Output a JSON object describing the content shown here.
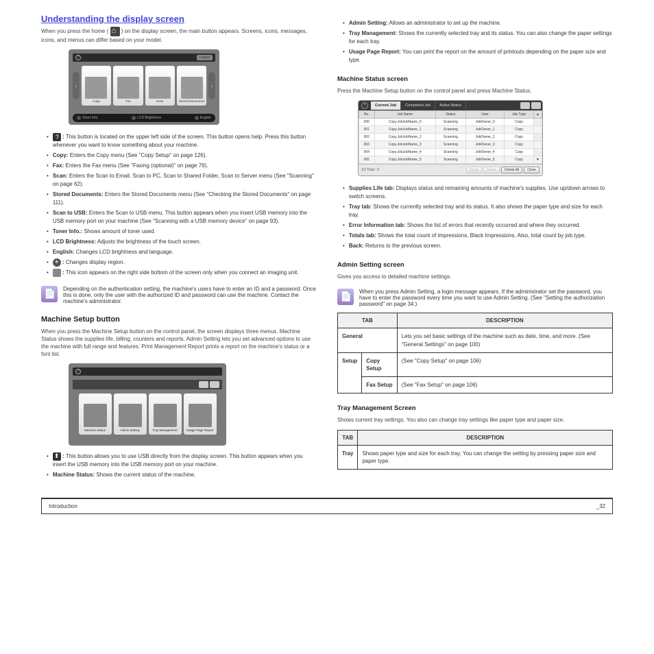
{
  "left": {
    "title": "Understanding the display screen",
    "intro_prefix": "When you press the home (",
    "intro_suffix": ") on the display screen, the main button appears. Screens, icons, messages, icons, and menus can differ based on your model.",
    "main_menu": {
      "topbar_right": "Logout",
      "tiles": [
        "Copy",
        "Fax",
        "Scan",
        "Stored Documents"
      ],
      "bottom": [
        "Toner Info.",
        "LCD Brightness",
        "English"
      ]
    },
    "bullets_1": [
      {
        "bold": ":",
        "text": "This button is located on the upper left side of the screen. This button opens help. Press this button whenever you want to know something about your machine."
      },
      {
        "bold": "Copy:",
        "text": "Enters the Copy menu (See \"Copy Setup\" on page 126)."
      },
      {
        "bold": "Fax:",
        "text": "Enters the Fax menu (See \"Faxing (optional)\" on page 76)."
      },
      {
        "bold": "Scan:",
        "text": "Enters the Scan to Email, Scan to PC, Scan to Shared Folder, Scan to Server menu (See \"Scanning\" on page 62)."
      },
      {
        "bold": "Stored Documents:",
        "text": "Enters the Stored Documents menu (See \"Checking the Stored Documents\" on page 111)."
      },
      {
        "bold": "Scan to USB:",
        "text": "Enters the Scan to USB menu. This button appears when you insert USB memory into the USB memory port on your machine (See \"Scanning with a USB memory device\" on page 93)."
      },
      {
        "bold": "Toner Info.:",
        "text": "Shows amount of toner used."
      },
      {
        "bold": "LCD Brightness:",
        "text": "Adjusts the brightness of the touch screen."
      },
      {
        "bold": "English:",
        "text": "Changes LCD brightness and language."
      },
      {
        "bold": ":",
        "text": "Changes display region."
      },
      {
        "bold": ":",
        "text": "This icon appears on the right side bottom of the screen only when you connect an imaging unit."
      }
    ],
    "note": "Depending on the authentication setting, the machine's users have to enter an ID and a password. Once this is done, only the user with the authorized ID and password can use the machine. Contact the machine's administrator.",
    "subsection_title": "Machine Setup button",
    "subsection_intro": "When you press the Machine Setup button on the control panel, the screen displays three menus. Machine Status shows the supplies life, billing, counters and reports. Admin Setting lets you set advanced options to use the machine with full range and features. Print Management Report prints a report on the machine's status or a font list.",
    "setup_screen": {
      "tiles": [
        "Machine Status",
        "Admin Setting",
        "Tray Management",
        "Usage Page Report"
      ]
    },
    "bullets_2": [
      {
        "bold": ":",
        "text": "This button allows you to use USB directly from the display screen. This button appears when you insert the USB memory into the USB memory port on your machine."
      },
      {
        "bold": "Machine Status:",
        "text": "Shows the current status of the machine."
      }
    ]
  },
  "right": {
    "bullets_top": [
      {
        "bold": "Admin Setting:",
        "text": "Allows an administrator to set up the machine."
      },
      {
        "bold": "Tray Management:",
        "text": "Shows the currently selected tray and its status. You can also change the paper settings for each tray."
      },
      {
        "bold": "Usage Page Report:",
        "text": "You can print the report on the amount of printouts depending on the paper size and type."
      }
    ],
    "machine_status_heading": "Machine Status screen",
    "machine_status_intro": "Press the Machine Setup button on the control panel and press Machine Status.",
    "job_status": {
      "tabs": [
        "Current Job",
        "Completed Job",
        "Active Notice"
      ],
      "columns": [
        "No.",
        "Job Name",
        "Status",
        "User",
        "Job Type"
      ],
      "rows": [
        [
          "000",
          "Copy.JobJobName_0",
          "Scanning",
          "JobOwner_0",
          "Copy"
        ],
        [
          "001",
          "Copy.JobJobName_1",
          "Scanning",
          "JobOwner_1",
          "Copy"
        ],
        [
          "002",
          "Copy.JobJobName_2",
          "Scanning",
          "JobOwner_2",
          "Copy"
        ],
        [
          "003",
          "Copy.JobJobName_3",
          "Scanning",
          "JobOwner_3",
          "Copy"
        ],
        [
          "004",
          "Copy.JobJobName_4",
          "Scanning",
          "JobOwner_4",
          "Copy"
        ],
        [
          "005",
          "Copy.JobJobName_5",
          "Scanning",
          "JobOwner_5",
          "Copy"
        ]
      ],
      "footer_left": "1/2        Total : 0",
      "footer_btns": [
        "Detail",
        "Delete",
        "Delete All",
        "Close"
      ]
    },
    "bullets_js": [
      {
        "bold": "Supplies Life tab:",
        "text": "Displays status and remaining amounts of machine's supplies. Use up/down arrows to switch screens."
      },
      {
        "bold": "Tray tab:",
        "text": "Shows the currently selected tray and its status. It also shows the paper type and size for each tray."
      },
      {
        "bold": "Error Information tab:",
        "text": "Shows the list of errors that recently occurred and where they occurred."
      },
      {
        "bold": "Totals tab:",
        "text": "Shows the total count of impressions, Black Impressions. Also, total count by job type."
      },
      {
        "bold": "Back:",
        "text": "Returns to the previous screen."
      }
    ],
    "admin_heading": "Admin Setting screen",
    "admin_intro": "Gives you access to detailed machine settings.",
    "admin_note": "When you press Admin Setting, a login message appears. If the administrator set the password, you have to enter the password every time you want to use Admin Setting. (See \"Setting the authorization password\" on page 34.)",
    "table1": {
      "headers": [
        "TAB",
        "DESCRIPTION"
      ],
      "rows": [
        [
          "General",
          "Lets you set basic settings of the machine such as date, time, and more. (See \"General Settings\" on page 100)"
        ]
      ],
      "nested": {
        "span": "Setup",
        "items": [
          [
            "Copy Setup",
            "(See \"Copy Setup\" on page 106)"
          ],
          [
            "Fax Setup",
            "(See \"Fax Setup\" on page 106)"
          ]
        ]
      }
    },
    "tray_heading": "Tray Management Screen",
    "tray_intro": "Shows current tray settings. You also can change tray settings like paper type and paper size.",
    "table2": {
      "headers": [
        "TAB",
        "DESCRIPTION"
      ],
      "rows": [
        [
          "Tray",
          "Shows paper type and size for each tray. You can change the setting by pressing paper size and paper type."
        ]
      ]
    }
  },
  "footer": {
    "left": "Introduction",
    "right": "_32"
  }
}
